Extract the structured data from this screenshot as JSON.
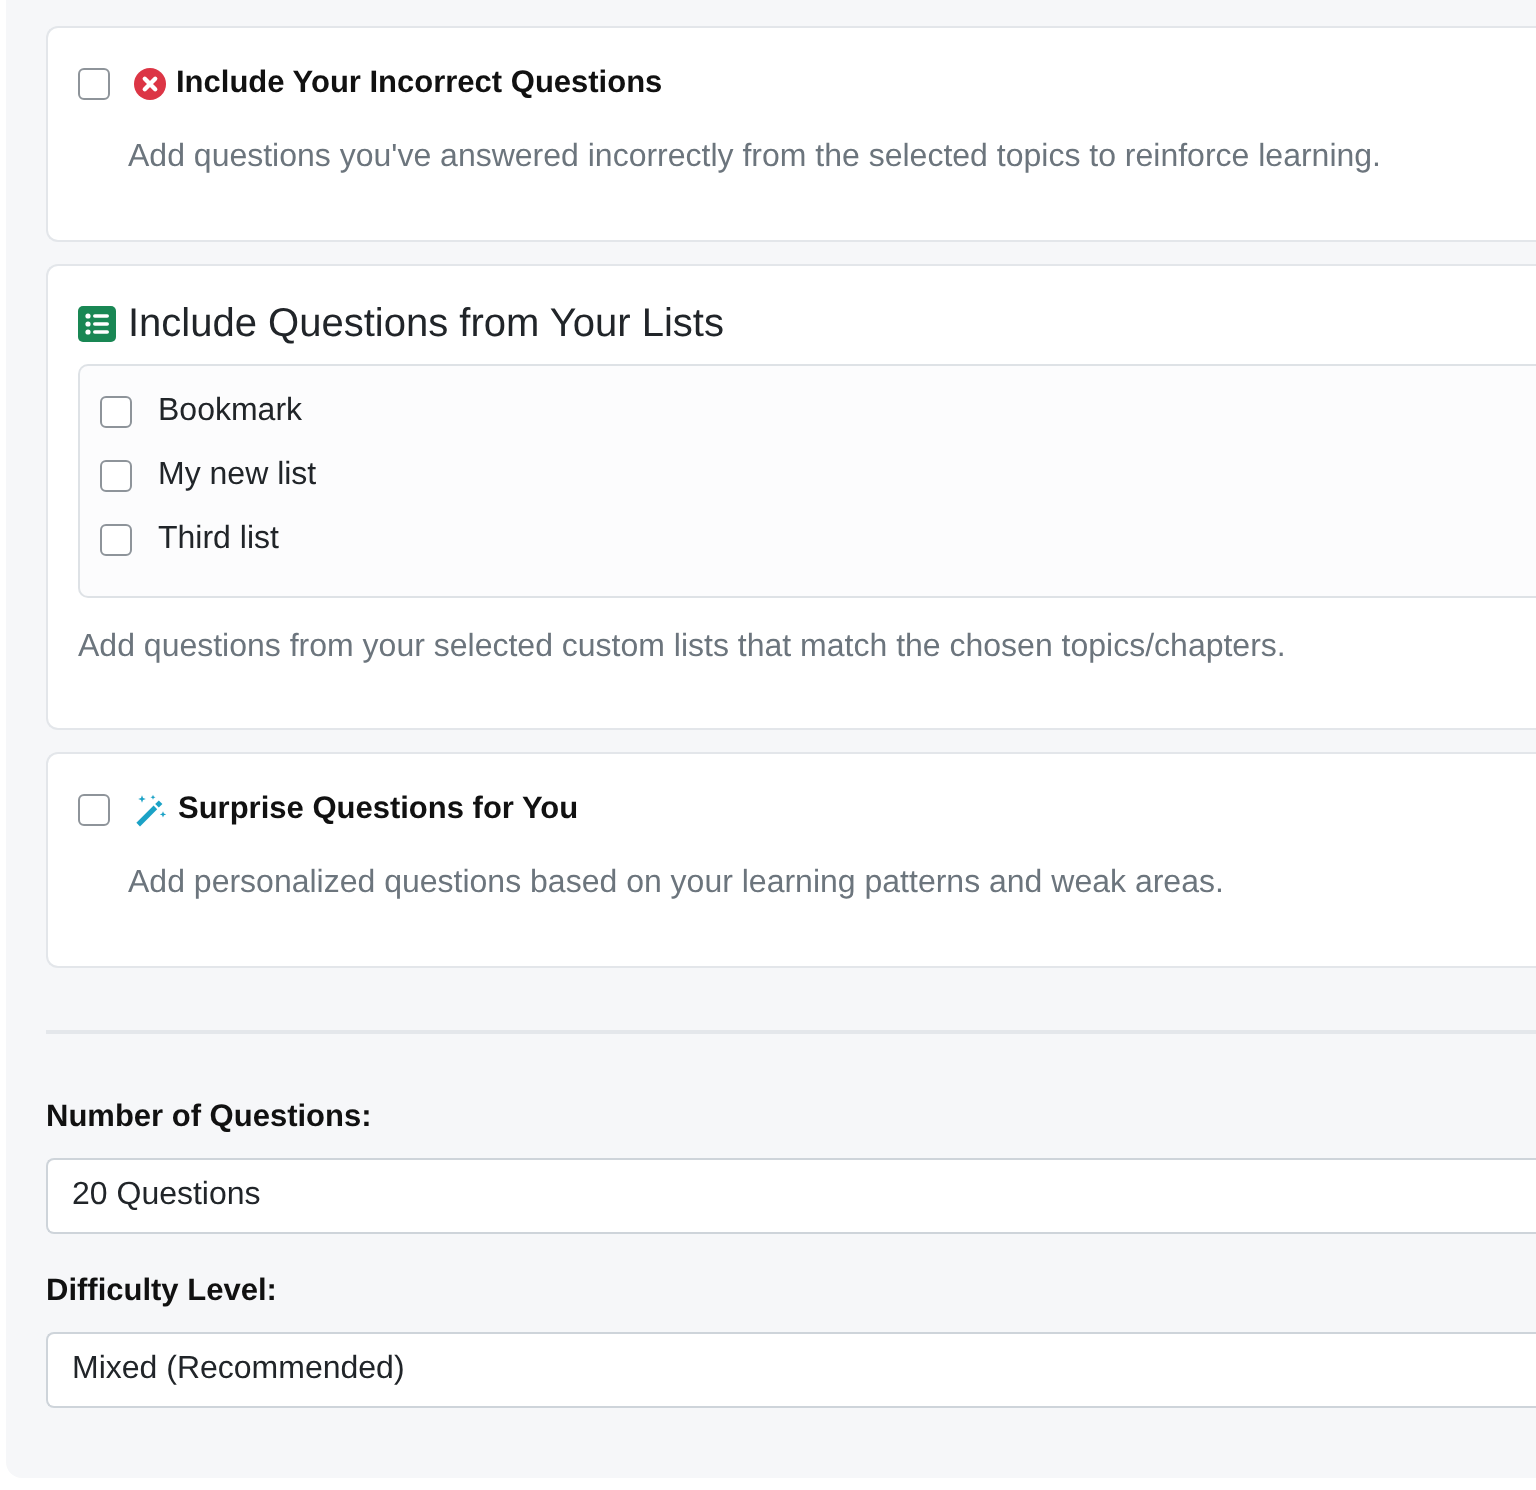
{
  "incorrect_questions": {
    "checked": false,
    "title": "Include Your Incorrect Questions",
    "description": "Add questions you've answered incorrectly from the selected topics to reinforce learning."
  },
  "question_lists": {
    "title": "Include Questions from Your Lists",
    "lists": [
      {
        "label": "Bookmark",
        "checked": false
      },
      {
        "label": "My new list",
        "checked": false
      },
      {
        "label": "Third list",
        "checked": false
      }
    ],
    "description": "Add questions from your selected custom lists that match the chosen topics/chapters."
  },
  "surprise_questions": {
    "checked": false,
    "title": "Surprise Questions for You",
    "description": "Add personalized questions based on your learning patterns and weak areas."
  },
  "settings": [
    {
      "label": "Number of Questions:",
      "value": "20 Questions"
    },
    {
      "label": "Difficulty Level:",
      "value": "Mixed (Recommended)"
    }
  ]
}
